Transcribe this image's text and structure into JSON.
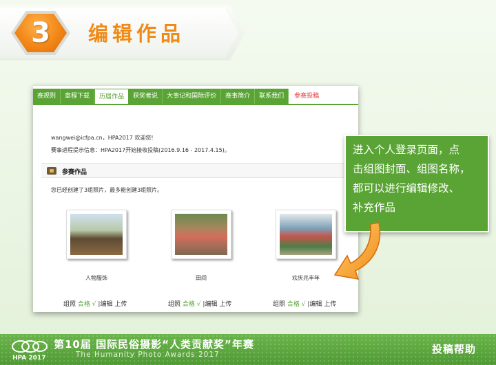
{
  "step": {
    "number": "3",
    "title": "编辑作品"
  },
  "nav": {
    "tabs": [
      {
        "label": "赛规则",
        "state": "normal"
      },
      {
        "label": "章程下载",
        "state": "normal"
      },
      {
        "label": "历届作品",
        "state": "active"
      },
      {
        "label": "获奖者说",
        "state": "normal"
      },
      {
        "label": "大事记和国际评价",
        "state": "normal"
      },
      {
        "label": "赛事简介",
        "state": "normal"
      },
      {
        "label": "联系我们",
        "state": "normal"
      },
      {
        "label": "参赛投稿",
        "state": "highlight"
      }
    ]
  },
  "page": {
    "welcome": "wangwei@icfpa.cn，HPA2017 欢迎您!",
    "notice": "赛事进程提示信息：HPA2017开始接收投稿(2016.9.16 - 2017.4.15)。",
    "section_title": "参赛作品",
    "count_text": "您已经创建了3组照片，最多能创建3组照片。",
    "photos": [
      {
        "caption": "人物服饰"
      },
      {
        "caption": "田间"
      },
      {
        "caption": "欢庆兆丰年"
      }
    ],
    "actions": {
      "group": "组照",
      "status": "合格",
      "check": "√",
      "edit": "|编辑",
      "upload": "上传"
    }
  },
  "callout": {
    "lines": [
      "进入个人登录页面，点",
      "击组图封面、组图名称，",
      "都可以进行编辑修改、",
      "补充作品"
    ]
  },
  "footer": {
    "logo_text": "HPA 2017",
    "title": "第10届 国际民俗摄影“人类贡献奖”年赛",
    "subtitle": "The Humanity Photo Awards 2017",
    "help": "投稿帮助"
  },
  "colors": {
    "accent_green": "#5aa435",
    "accent_orange": "#f08a16",
    "highlight_red": "#e23a3a"
  }
}
